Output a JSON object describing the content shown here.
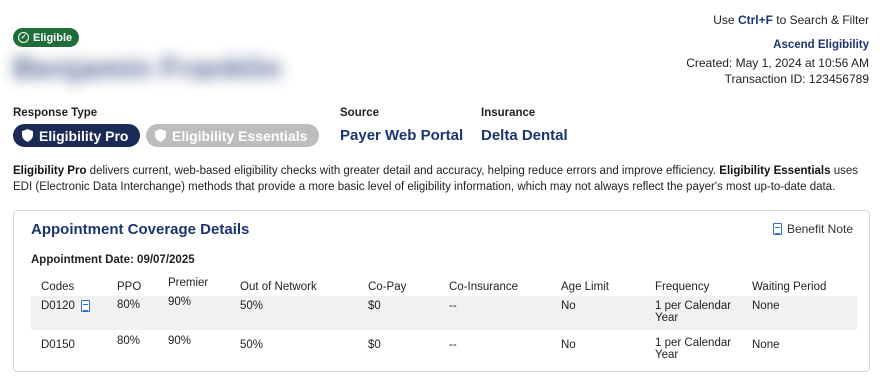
{
  "status_badge": "Eligible",
  "patient_name": "Benjamin Franklin",
  "header": {
    "search_hint_pre": "Use ",
    "search_hint_key": "Ctrl+F",
    "search_hint_post": " to Search & Filter",
    "product": "Ascend Eligibility",
    "created": "Created: May 1, 2024 at 10:56 AM",
    "transaction": "Transaction ID: 123456789"
  },
  "response_type": {
    "label": "Response Type",
    "options": [
      "Eligibility Pro",
      "Eligibility Essentials"
    ]
  },
  "source": {
    "label": "Source",
    "value": "Payer Web Portal"
  },
  "insurance": {
    "label": "Insurance",
    "value": "Delta Dental"
  },
  "description": {
    "pro_term": "Eligibility Pro",
    "pro_text": " delivers current, web-based eligibility checks with greater detail and accuracy, helping reduce errors and improve efficiency. ",
    "ess_term": "Eligibility Essentials",
    "ess_text": " uses EDI (Electronic Data Interchange) methods that provide a more basic level of eligibility information, which may not always reflect the payer's most up-to-date data."
  },
  "coverage": {
    "title": "Appointment Coverage Details",
    "benefit_note": "Benefit Note",
    "appointment_date": "Appointment Date: 09/07/2025",
    "columns": [
      "Codes",
      "PPO",
      "Premier",
      "Out of Network",
      "Co-Pay",
      "Co-Insurance",
      "Age Limit",
      "Frequency",
      "Waiting Period"
    ],
    "rows": [
      {
        "code": "D0120",
        "ppo": "80%",
        "premier": "90%",
        "oon": "50%",
        "copay": "$0",
        "coins": "--",
        "age": "No",
        "freq": "1 per Calendar Year",
        "wait": "None"
      },
      {
        "code": "D0150",
        "ppo": "80%",
        "premier": "90%",
        "oon": "50%",
        "copay": "$0",
        "coins": "--",
        "age": "No",
        "freq": "1 per Calendar Year",
        "wait": "None"
      }
    ]
  },
  "colors": {
    "navy": "#1b3570",
    "pill_active": "#1b2a56",
    "pill_inactive": "#bdbdbd",
    "success": "#1f6e3a",
    "icon_blue": "#2f6fd1"
  },
  "icons": [
    "check-circle-icon",
    "shield-icon",
    "document-icon"
  ]
}
